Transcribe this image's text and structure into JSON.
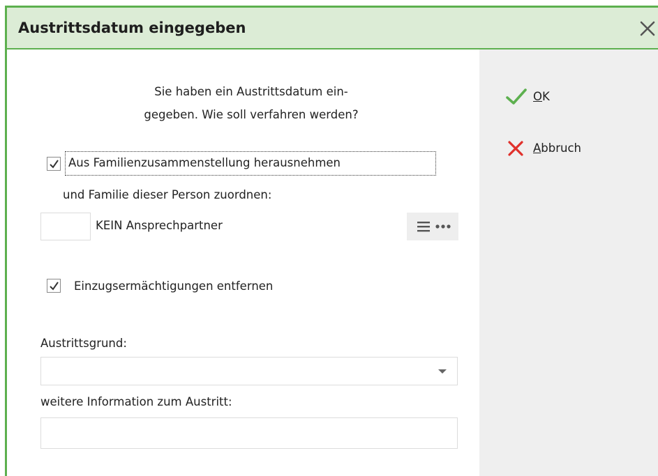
{
  "dialog": {
    "title": "Austrittsdatum eingegeben",
    "message_line1": "Sie haben ein Austrittsdatum ein-",
    "message_line2": "gegeben. Wie soll verfahren werden?"
  },
  "family": {
    "checkbox_checked": true,
    "label": "Aus Familienzusammenstellung herausnehmen",
    "label_line2": "und Familie dieser Person zuordnen:",
    "person_value": "",
    "person_label": "KEIN Ansprechpartner"
  },
  "direct_debit": {
    "checkbox_checked": true,
    "label": "Einzugsermächtigungen entfernen"
  },
  "reason": {
    "label": "Austrittsgrund:",
    "selected": ""
  },
  "info": {
    "label": "weitere Information zum Austritt:",
    "value": ""
  },
  "actions": {
    "ok_mnemonic": "O",
    "ok_rest": "K",
    "cancel_mnemonic": "A",
    "cancel_rest": "bbruch"
  },
  "colors": {
    "accent_green": "#5db04f",
    "titlebar_bg": "#dcecd6",
    "cancel_red": "#e0302b"
  },
  "icons": {
    "close": "close-icon",
    "ok": "checkmark-icon",
    "cancel": "cross-icon",
    "list": "list-icon",
    "more": "more-dots-icon",
    "dropdown": "caret-down-icon"
  }
}
